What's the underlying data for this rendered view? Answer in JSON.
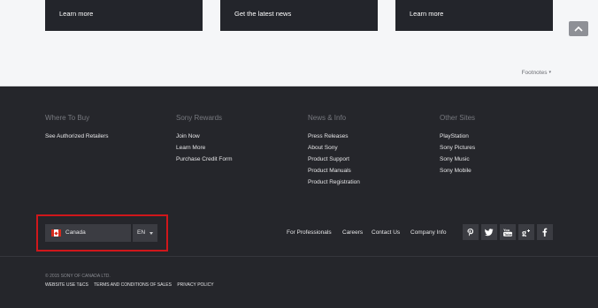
{
  "promo": {
    "cards": [
      {
        "label": "Learn more"
      },
      {
        "label": "Get the latest news"
      },
      {
        "label": "Learn more"
      }
    ],
    "footnotes_label": "Footnotes",
    "scroll_top_icon": "chevron-up-icon"
  },
  "footer": {
    "columns": [
      {
        "heading": "Where To Buy",
        "links": [
          "See Authorized Retailers"
        ]
      },
      {
        "heading": "Sony Rewards",
        "links": [
          "Join Now",
          "Learn More",
          "Purchase Credit Form"
        ]
      },
      {
        "heading": "News & Info",
        "links": [
          "Press Releases",
          "About Sony",
          "Product Support",
          "Product Manuals",
          "Product Registration"
        ]
      },
      {
        "heading": "Other Sites",
        "links": [
          "PlayStation",
          "Sony Pictures",
          "Sony Music",
          "Sony Mobile"
        ]
      }
    ],
    "region": {
      "country": "Canada",
      "language": "EN",
      "highlight_color": "#d0171b"
    },
    "utility_links": [
      "For Professionals",
      "Careers",
      "Contact Us",
      "Company Info"
    ],
    "social": [
      "pinterest-icon",
      "twitter-icon",
      "youtube-icon",
      "google-plus-icon",
      "facebook-icon"
    ],
    "copyright": "© 2015 SONY OF CANADA LTD.",
    "legal_links": [
      "WEBSITE USE T&CS",
      "TERMS AND CONDITIONS OF SALES",
      "PRIVACY POLICY"
    ]
  },
  "colors": {
    "footer_bg": "#25262b",
    "card_bg": "#23252b",
    "page_bg": "#f5f6f8"
  }
}
